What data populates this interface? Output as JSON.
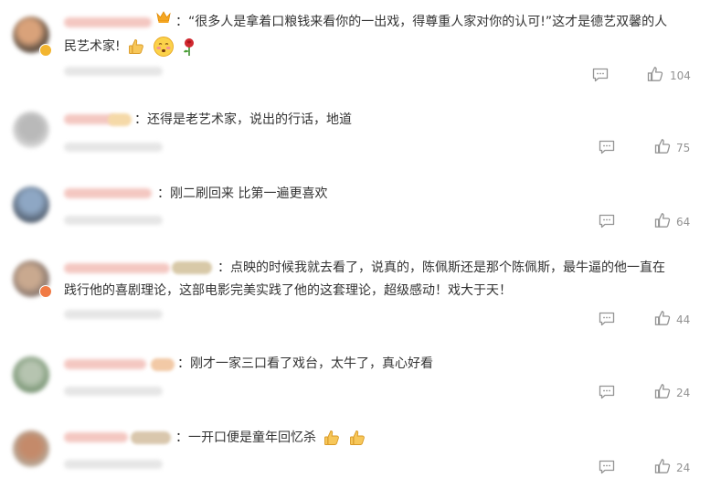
{
  "comments": [
    {
      "text_line1": "：“很多人是拿着口粮钱来看你的一出戏，得尊重人家对你的认可!”这才是德艺双馨的人",
      "text_line2": "民艺术家!",
      "likes": "104",
      "reply_icon": "comment-icon",
      "like_icon": "thumbs-up-icon"
    },
    {
      "text_line1": "：还得是老艺术家，说出的行话，地道",
      "likes": "75"
    },
    {
      "text_line1": "：刚二刷回来 比第一遍更喜欢",
      "likes": "64"
    },
    {
      "text_line1": "：点映的时候我就去看了，说真的，陈佩斯还是那个陈佩斯，最牛逼的他一直在",
      "text_line2": "践行他的喜剧理论，这部电影完美实践了他的这套理论，超级感动！戏大于天！",
      "likes": "44"
    },
    {
      "text_line1": "：刚才一家三口看了戏台，太牛了，真心好看",
      "likes": "24"
    },
    {
      "text_line1": "：一开口便是童年回忆杀",
      "likes": "24"
    }
  ],
  "colors": {
    "text": "#333333",
    "muted": "#939393",
    "crown": "#f3b52f"
  }
}
